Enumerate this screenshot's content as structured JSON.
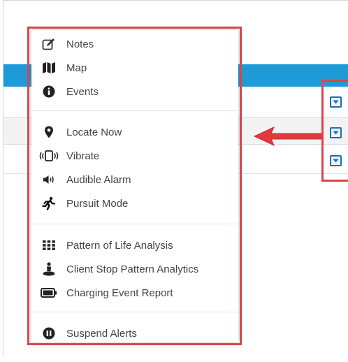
{
  "menu": {
    "items": [
      {
        "label": "Notes",
        "icon": "edit-icon"
      },
      {
        "label": "Map",
        "icon": "map-icon"
      },
      {
        "label": "Events",
        "icon": "info-icon"
      },
      {
        "label": "Locate Now",
        "icon": "location-pin-icon"
      },
      {
        "label": "Vibrate",
        "icon": "vibrate-icon"
      },
      {
        "label": "Audible Alarm",
        "icon": "speaker-icon"
      },
      {
        "label": "Pursuit Mode",
        "icon": "running-person-icon"
      },
      {
        "label": "Pattern of Life Analysis",
        "icon": "grid-dots-icon"
      },
      {
        "label": "Client Stop Pattern Analytics",
        "icon": "person-marker-icon"
      },
      {
        "label": "Charging Event Report",
        "icon": "battery-icon"
      },
      {
        "label": "Suspend Alerts",
        "icon": "pause-icon"
      }
    ]
  },
  "colors": {
    "highlight": "#d9464b",
    "header": "#1e9ad6",
    "dropdown_button": "#1f6fb2"
  },
  "dropdown_buttons": [
    {
      "icon": "caret-down-icon"
    },
    {
      "icon": "caret-down-icon"
    },
    {
      "icon": "caret-down-icon"
    }
  ]
}
